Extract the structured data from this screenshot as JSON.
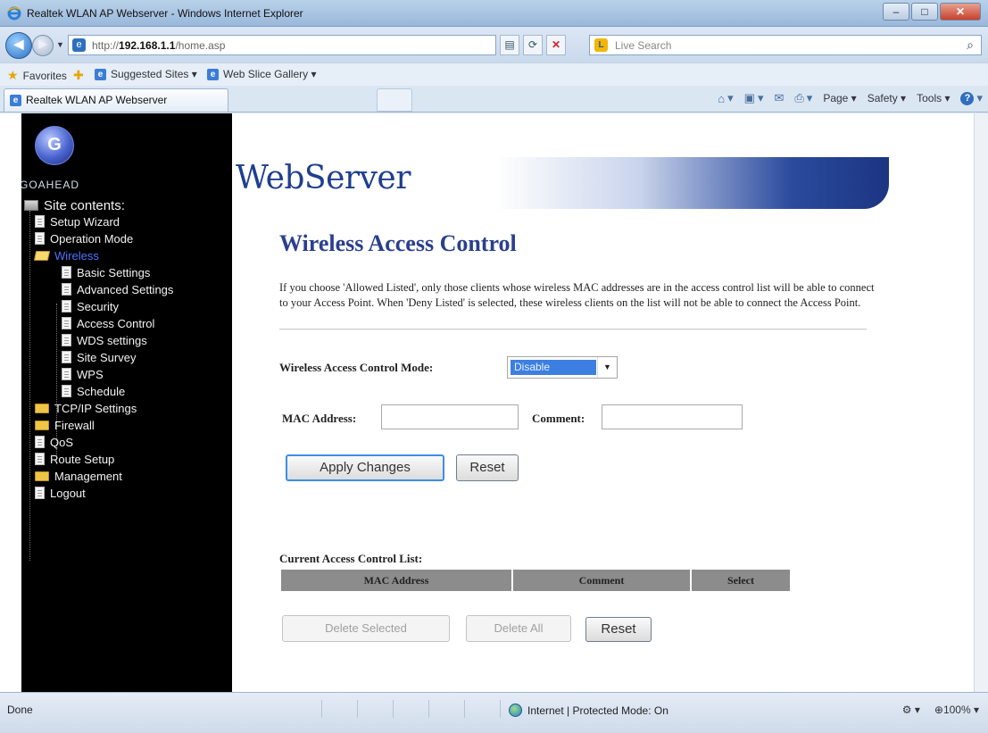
{
  "window": {
    "title": "Realtek WLAN AP Webserver - Windows Internet Explorer",
    "buttons": {
      "minimize": "–",
      "maximize": "□",
      "close": "✕"
    }
  },
  "address_bar": {
    "url_prefix": "http://",
    "url_host": "192.168.1.1",
    "url_path": "/home.asp",
    "search_placeholder": "Live Search"
  },
  "favorites_bar": {
    "favorites_label": "Favorites",
    "suggested_sites": "Suggested Sites ▾",
    "web_slice": "Web Slice Gallery ▾"
  },
  "tab": {
    "label": "Realtek WLAN AP Webserver"
  },
  "command_bar": {
    "page": "Page ▾",
    "safety": "Safety ▾",
    "tools": "Tools ▾"
  },
  "nav": {
    "logo_text": "GOAHEAD",
    "site_contents": "Site contents:",
    "items": [
      "Setup Wizard",
      "Operation Mode",
      "Wireless",
      "Basic Settings",
      "Advanced Settings",
      "Security",
      "Access Control",
      "WDS settings",
      "Site Survey",
      "WPS",
      "Schedule",
      "TCP/IP Settings",
      "Firewall",
      "QoS",
      "Route Setup",
      "Management",
      "Logout"
    ]
  },
  "banner": {
    "title": "WebServer"
  },
  "content": {
    "title": "Wireless Access Control",
    "description": "If you choose 'Allowed Listed', only those clients whose wireless MAC addresses are in the access control list will be able to connect to your Access Point. When 'Deny Listed' is selected, these wireless clients on the list will not be able to connect the Access Point.",
    "mode_label": "Wireless Access Control Mode:",
    "mode_value": "Disable",
    "mac_label": "MAC Address:",
    "mac_value": "",
    "comment_label": "Comment:",
    "comment_value": "",
    "apply_button": "Apply Changes",
    "reset_button": "Reset",
    "list_title": "Current Access Control List:",
    "columns": [
      "MAC Address",
      "Comment",
      "Select"
    ],
    "delete_selected": "Delete Selected",
    "delete_all": "Delete All",
    "reset_button_2": "Reset"
  },
  "status_bar": {
    "status": "Done",
    "zone": "Internet | Protected Mode: On",
    "zoom": "100%"
  },
  "colors": {
    "title_blue": "#2b3f8f",
    "banner_blue": "#1b3582",
    "nav_bg": "#000000",
    "selected_blue": "#3d7fe0",
    "table_header": "#8c8c8c"
  }
}
